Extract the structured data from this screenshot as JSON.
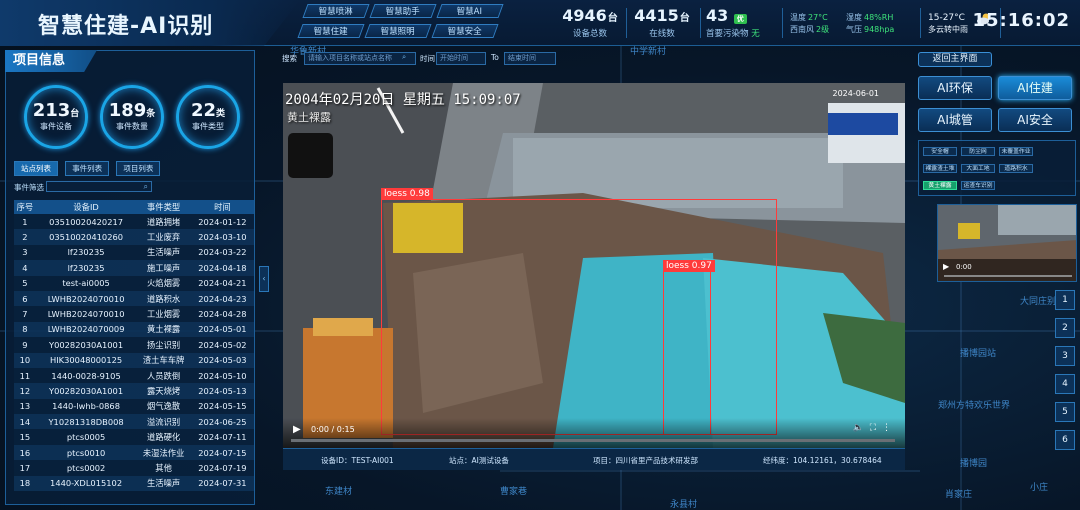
{
  "header": {
    "title": "智慧住建-AI识别",
    "nav_buttons": [
      "智慧喷淋",
      "智慧助手",
      "智慧AI",
      "智慧住建",
      "智慧照明",
      "智慧安全"
    ],
    "stats": [
      {
        "value": "4946",
        "unit": "台",
        "label": "设备总数"
      },
      {
        "value": "4415",
        "unit": "台",
        "label": "在线数"
      },
      {
        "value": "43",
        "unit": "",
        "label": "首要污染物"
      }
    ],
    "aqi_badge": "优",
    "aqi_extra": "无",
    "weather": {
      "temp_label": "温度",
      "temp": "27°C",
      "wind_label": "西南风",
      "wind": "2级",
      "humidity_label": "湿度",
      "humidity": "48%RH",
      "pressure_label": "气压",
      "pressure": "948hpa",
      "forecast_temp": "15-27°C",
      "forecast_text": "多云转中雨"
    },
    "time": "15:16:02"
  },
  "left_panel": {
    "title": "项目信息",
    "rings": [
      {
        "value": "213",
        "unit": "台",
        "label": "事件设备"
      },
      {
        "value": "189",
        "unit": "条",
        "label": "事件数量"
      },
      {
        "value": "22",
        "unit": "类",
        "label": "事件类型"
      }
    ],
    "tabs": [
      "站点列表",
      "事件列表",
      "项目列表"
    ],
    "filter_label": "事件筛选",
    "table": {
      "headers": [
        "序号",
        "设备ID",
        "事件类型",
        "时间"
      ],
      "rows": [
        [
          "1",
          "03510020420217",
          "道路拥堵",
          "2024-01-12"
        ],
        [
          "2",
          "03510020410260",
          "工业废弃",
          "2024-03-10"
        ],
        [
          "3",
          "lf230235",
          "生活噪声",
          "2024-03-22"
        ],
        [
          "4",
          "lf230235",
          "施工噪声",
          "2024-04-18"
        ],
        [
          "5",
          "test-ai0005",
          "火焰烟雾",
          "2024-04-21"
        ],
        [
          "6",
          "LWHB2024070010",
          "道路积水",
          "2024-04-23"
        ],
        [
          "7",
          "LWHB2024070010",
          "工业烟雾",
          "2024-04-28"
        ],
        [
          "8",
          "LWHB2024070009",
          "黄土裸露",
          "2024-05-01"
        ],
        [
          "9",
          "Y00282030A1001",
          "扬尘识别",
          "2024-05-02"
        ],
        [
          "10",
          "HIK30048000125",
          "渣土车车牌",
          "2024-05-03"
        ],
        [
          "11",
          "1440-0028-9105",
          "人员跌倒",
          "2024-05-10"
        ],
        [
          "12",
          "Y00282030A1001",
          "露天烧烤",
          "2024-05-13"
        ],
        [
          "13",
          "1440-lwhb-0868",
          "烟气逸散",
          "2024-05-15"
        ],
        [
          "14",
          "Y10281318DB008",
          "溢流识别",
          "2024-06-25"
        ],
        [
          "15",
          "ptcs0005",
          "道路硬化",
          "2024-07-11"
        ],
        [
          "16",
          "ptcs0010",
          "未湿法作业",
          "2024-07-15"
        ],
        [
          "17",
          "ptcs0002",
          "其他",
          "2024-07-19"
        ],
        [
          "18",
          "1440-XDL015102",
          "生活噪声",
          "2024-07-31"
        ]
      ]
    }
  },
  "search": {
    "label": "搜索",
    "placeholder": "请输入项目名称或站点名称",
    "time_label": "时间",
    "start_placeholder": "开始时间",
    "to_label": "To",
    "end_placeholder": "结束时间"
  },
  "video": {
    "overlay_datetime": "2004年02月20日  星期五  15:09:07",
    "overlay_subtitle": "黄土裸露",
    "overlay_date_right": "2024-06-01",
    "detections": [
      {
        "label": "loess",
        "confidence": "0.98"
      },
      {
        "label": "loess",
        "confidence": "0.97"
      }
    ],
    "current_time": "0:00",
    "duration": "0:15",
    "time_display": "0:00 / 0:15",
    "progress": 0.0,
    "info": {
      "device": "设备ID：TEST-AI001",
      "site": "站点：AI测试设备",
      "project": "项目：四川省里产品技术研发部",
      "coords": "经纬度：104.12161，30.678464"
    }
  },
  "right_panel": {
    "return_label": "返回主界面",
    "ai_buttons": [
      "AI环保",
      "AI住建",
      "AI城管",
      "AI安全"
    ],
    "active_ai": "AI住建",
    "categories": [
      "安全帽",
      "防尘网",
      "未覆盖作业",
      "裸露渣土堆",
      "大面工地",
      "道路积水",
      "黄土裸露",
      "运渣车识别"
    ],
    "active_category": "黄土裸露",
    "thumb_time": "0:00",
    "side_numbers": [
      "1",
      "2",
      "3",
      "4",
      "5",
      "6"
    ]
  },
  "map_labels": [
    "华鲁新村",
    "中学新村",
    "东建材",
    "曹家巷",
    "大同庄别院",
    "播博园站",
    "郑州方特欢乐世界",
    "播博园",
    "肖家庄",
    "永县村",
    "小庄"
  ],
  "colors": {
    "accent": "#1aa5e6",
    "bbox": "#ff3b3b",
    "active_chip": "#17a06c"
  }
}
